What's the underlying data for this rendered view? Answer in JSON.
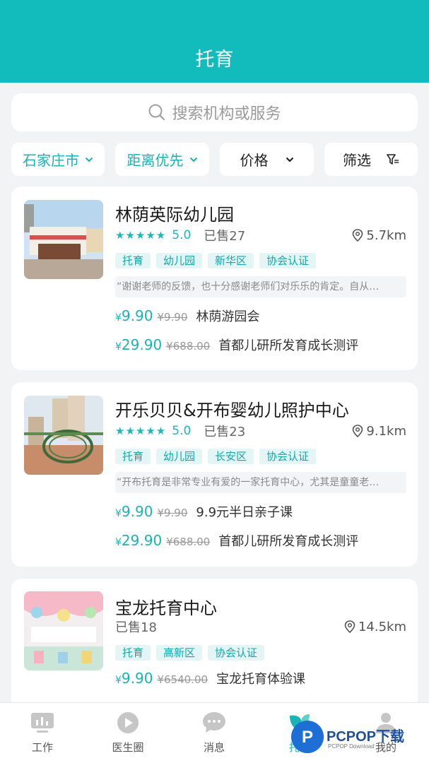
{
  "header": {
    "title": "托育"
  },
  "search": {
    "placeholder": "搜索机构或服务"
  },
  "filters": [
    {
      "label": "石家庄市"
    },
    {
      "label": "距离优先"
    },
    {
      "label": "价格"
    },
    {
      "label": "筛选"
    }
  ],
  "cards": [
    {
      "title": "林荫英际幼儿园",
      "stars": "★★★★★",
      "score": "5.0",
      "sold": "已售27",
      "distance": "5.7km",
      "tags": [
        "托育",
        "幼儿园",
        "新华区",
        "协会认证"
      ],
      "review": "“谢谢老师的反馈，也十分感谢老师们对乐乐的肯定。自从…",
      "offers": [
        {
          "currency": "¥",
          "price": "9.90",
          "original": "¥9.90",
          "name": "林荫游园会"
        },
        {
          "currency": "¥",
          "price": "29.90",
          "original": "¥688.00",
          "name": "首都儿研所发育成长测评"
        }
      ]
    },
    {
      "title": "开乐贝贝&开布婴幼儿照护中心",
      "stars": "★★★★★",
      "score": "5.0",
      "sold": "已售23",
      "distance": "9.1km",
      "tags": [
        "托育",
        "幼儿园",
        "长安区",
        "协会认证"
      ],
      "review": "“开布托育是非常专业有爱的一家托育中心，尤其是童童老…",
      "offers": [
        {
          "currency": "¥",
          "price": "9.90",
          "original": "¥9.90",
          "name": "9.9元半日亲子课"
        },
        {
          "currency": "¥",
          "price": "29.90",
          "original": "¥688.00",
          "name": "首都儿研所发育成长测评"
        }
      ]
    },
    {
      "title": "宝龙托育中心",
      "sold": "已售18",
      "distance": "14.5km",
      "tags": [
        "托育",
        "高新区",
        "协会认证"
      ],
      "offers": [
        {
          "currency": "¥",
          "price": "9.90",
          "original": "¥6540.00",
          "name": "宝龙托育体验课"
        }
      ]
    }
  ],
  "tabbar": [
    {
      "label": "工作",
      "icon": "monitor-icon"
    },
    {
      "label": "医生圈",
      "icon": "play-circle-icon"
    },
    {
      "label": "消息",
      "icon": "chat-icon"
    },
    {
      "label": "托育",
      "icon": "leaf-icon",
      "active": true
    },
    {
      "label": "我的",
      "icon": "user-icon"
    }
  ],
  "watermark": {
    "main": "PCPOP下载",
    "sub": "PCPOP Download"
  },
  "colors": {
    "accent": "#13bcbc",
    "background": "#f2f3f5"
  }
}
